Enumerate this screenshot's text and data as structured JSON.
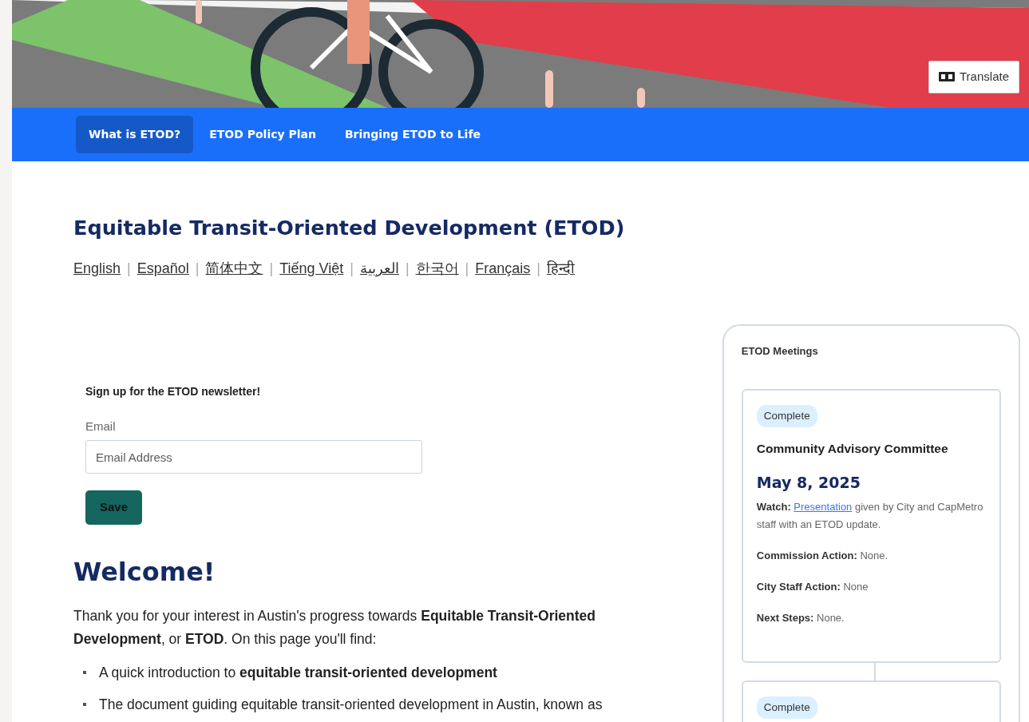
{
  "banner": {
    "translate_button": "Translate"
  },
  "nav": [
    {
      "label": "What is ETOD?",
      "selected": true
    },
    {
      "label": "ETOD Policy Plan",
      "selected": false
    },
    {
      "label": "Bringing ETOD to Life",
      "selected": false
    }
  ],
  "page_title": "Equitable Transit-Oriented Development (ETOD)",
  "languages": [
    {
      "label": "English",
      "separator": "|"
    },
    {
      "label": "Español",
      "separator": "|"
    },
    {
      "label": "简体中文",
      "separator": "|"
    },
    {
      "label": "Tiếng Việt",
      "separator": "|"
    },
    {
      "label": "العربية",
      "separator": "|"
    },
    {
      "label": "한국어",
      "separator": "|"
    },
    {
      "label": "Français",
      "separator": "|"
    },
    {
      "label": "हिन्दी"
    }
  ],
  "newsletter": {
    "heading": "Sign up for the ETOD newsletter!",
    "email_label": "Email",
    "placeholder": "Email Address",
    "button": "Save"
  },
  "welcome": {
    "heading": "Welcome!",
    "intro": "Thank you for your interest in Austin's progress towards **Equitable Transit-Oriented Development**, or **ETOD**. On this page you'll find:",
    "bullets": [
      "A quick introduction to **equitable transit-oriented development**",
      "The document guiding equitable transit-oriented development in Austin, known as"
    ]
  },
  "meetings": {
    "title": "ETOD Meetings",
    "items": [
      {
        "status": "Complete",
        "committee": "Community Advisory Committee",
        "date": "May 8, 2025",
        "details": [
          {
            "kind": "link",
            "label": "Watch:",
            "link": "Presentation",
            "text": "given by City and CapMetro staff with an ETOD update."
          },
          {
            "kind": "plain",
            "label": "Commission Action:",
            "text": "None."
          },
          {
            "kind": "plain",
            "label": "City Staff Action:",
            "text": "None"
          },
          {
            "kind": "plain",
            "label": "Next Steps:",
            "text": "None."
          }
        ]
      },
      {
        "status": "Complete"
      }
    ]
  }
}
